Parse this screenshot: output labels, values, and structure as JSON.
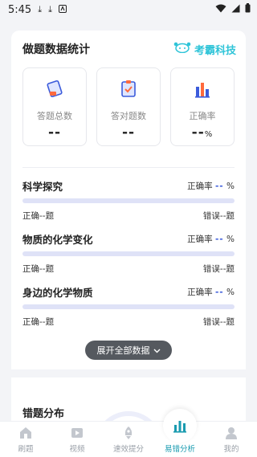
{
  "status_bar": {
    "time": "5:45"
  },
  "card": {
    "title": "做题数据统计",
    "brand": "考霸科技",
    "stats": [
      {
        "label": "答题总数",
        "value": "--",
        "icon": "book-icon"
      },
      {
        "label": "答对题数",
        "value": "--",
        "icon": "clipboard-check-icon"
      },
      {
        "label": "正确率",
        "value": "--",
        "unit": "%",
        "icon": "bar-chart-icon"
      }
    ],
    "subjects": [
      {
        "name": "科学探究",
        "accuracy_label": "正确率",
        "accuracy_value": "--",
        "unit": "%",
        "correct": "正确--题",
        "wrong": "错误--题"
      },
      {
        "name": "物质的化学变化",
        "accuracy_label": "正确率",
        "accuracy_value": "--",
        "unit": "%",
        "correct": "正确--题",
        "wrong": "错误--题"
      },
      {
        "name": "身边的化学物质",
        "accuracy_label": "正确率",
        "accuracy_value": "--",
        "unit": "%",
        "correct": "正确--题",
        "wrong": "错误--题"
      }
    ],
    "expand_label": "展开全部数据",
    "error_section_title": "错题分布"
  },
  "tabbar": {
    "items": [
      {
        "label": "刷题",
        "icon": "home-icon"
      },
      {
        "label": "视频",
        "icon": "video-icon"
      },
      {
        "label": "速效提分",
        "icon": "rocket-icon"
      },
      {
        "label": "易错分析",
        "icon": "analysis-icon",
        "active": true
      },
      {
        "label": "我的",
        "icon": "profile-icon"
      }
    ]
  },
  "colors": {
    "accent": "#1a9bb0",
    "brand": "#2ec4d8",
    "dash": "#3b5bdb",
    "bar": "#dfe2f7"
  }
}
